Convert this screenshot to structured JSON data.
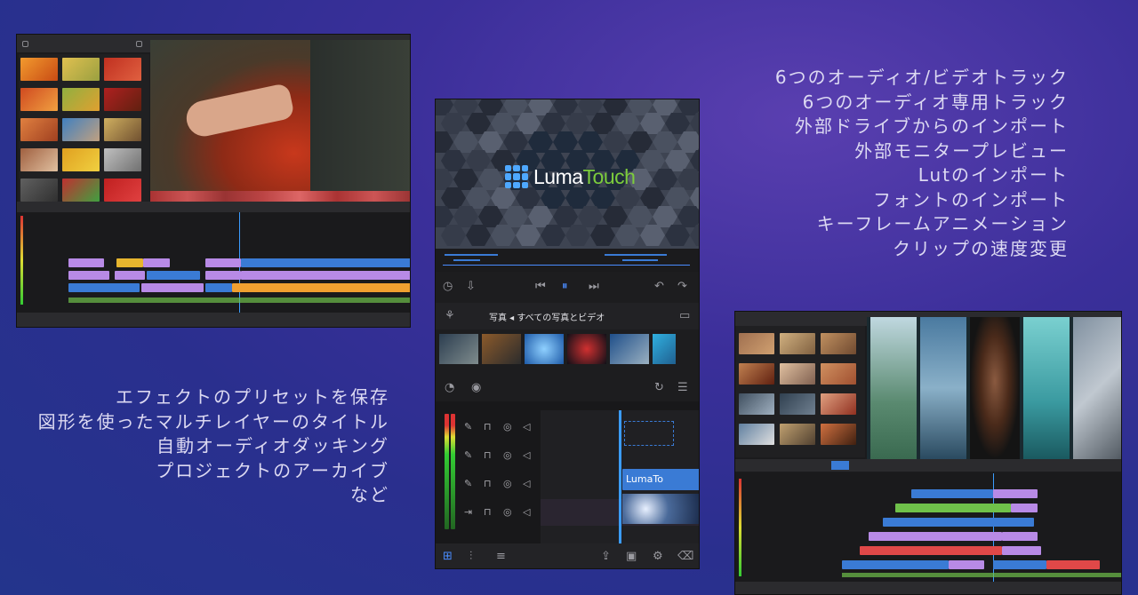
{
  "features_right": [
    "6つのオーディオ/ビデオトラック",
    "6つのオーディオ専用トラック",
    "外部ドライブからのインポート",
    "外部モニタープレビュー",
    "Lutのインポート",
    "フォントのインポート",
    "キーフレームアニメーション",
    "クリップの速度変更"
  ],
  "features_left": [
    "エフェクトのプリセットを保存",
    "図形を使ったマルチレイヤーのタイトル",
    "自動オーディオダッキング",
    "プロジェクトのアーカイブ",
    "など"
  ],
  "center_app": {
    "logo_word_a": "Luma",
    "logo_word_b": "Touch",
    "media_title": "写真 ◂ すべての写真とビデオ",
    "title_clip_label": "LumaTo"
  },
  "colors": {
    "background": "#2e3090",
    "feature_text": "#dcd9f2",
    "timeline_blue": "#3a7bd5",
    "timeline_purple": "#b88ae6",
    "timeline_yellow": "#e6b52e",
    "timeline_green": "#6fc14a",
    "timeline_orange": "#f0a030",
    "timeline_red": "#e04848",
    "accent_blue": "#4ea8ff"
  },
  "icons": [
    "undo-icon",
    "redo-icon",
    "play-icon",
    "skip-back-icon",
    "skip-forward-icon",
    "settings-icon",
    "share-icon",
    "export-icon",
    "mic-icon",
    "speaker-icon",
    "scissors-icon",
    "trash-icon"
  ]
}
